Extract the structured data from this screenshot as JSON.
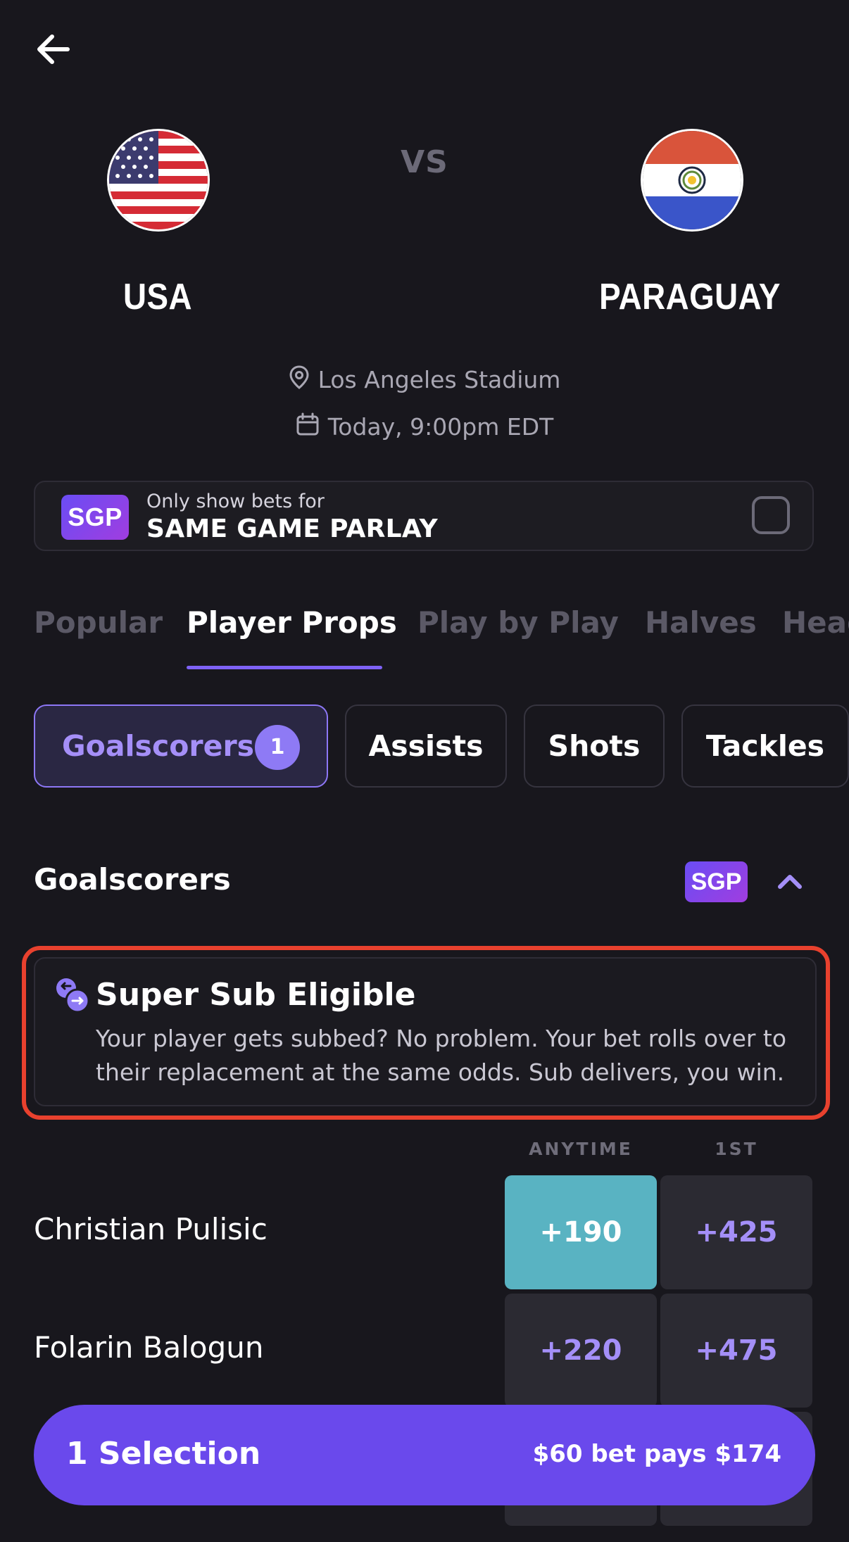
{
  "match": {
    "vs_label": "VS",
    "home_team": "USA",
    "away_team": "PARAGUAY",
    "venue": "Los Angeles Stadium",
    "datetime": "Today, 9:00pm EDT"
  },
  "sgp_filter": {
    "badge": "SGP",
    "caption": "Only show bets for",
    "title": "SAME GAME PARLAY",
    "checked": false
  },
  "tabs": [
    {
      "label": "Popular",
      "active": false
    },
    {
      "label": "Player Props",
      "active": true
    },
    {
      "label": "Play by Play",
      "active": false
    },
    {
      "label": "Halves",
      "active": false
    },
    {
      "label": "Head",
      "active": false
    }
  ],
  "chips": [
    {
      "label": "Goalscorers",
      "count": "1",
      "active": true
    },
    {
      "label": "Assists",
      "active": false
    },
    {
      "label": "Shots",
      "active": false
    },
    {
      "label": "Tackles",
      "active": false
    }
  ],
  "section": {
    "title": "Goalscorers",
    "badge": "SGP"
  },
  "super_sub": {
    "title": "Super Sub Eligible",
    "description": "Your player gets subbed? No problem. Your bet rolls over to their replacement at the same odds. Sub delivers, you win."
  },
  "odds_table": {
    "columns": [
      "ANYTIME",
      "1ST"
    ],
    "rows": [
      {
        "player": "Christian Pulisic",
        "anytime": "+190",
        "first": "+425",
        "anytime_selected": true
      },
      {
        "player": "Folarin Balogun",
        "anytime": "+220",
        "first": "+475",
        "anytime_selected": false
      }
    ]
  },
  "bet_slip": {
    "selection_label": "1 Selection",
    "payout_label": "$60 bet pays $174"
  },
  "colors": {
    "background": "#18171d",
    "accent": "#6a49ec",
    "selected_odds": "#59b3c2",
    "highlight_outline": "#e8412e"
  }
}
